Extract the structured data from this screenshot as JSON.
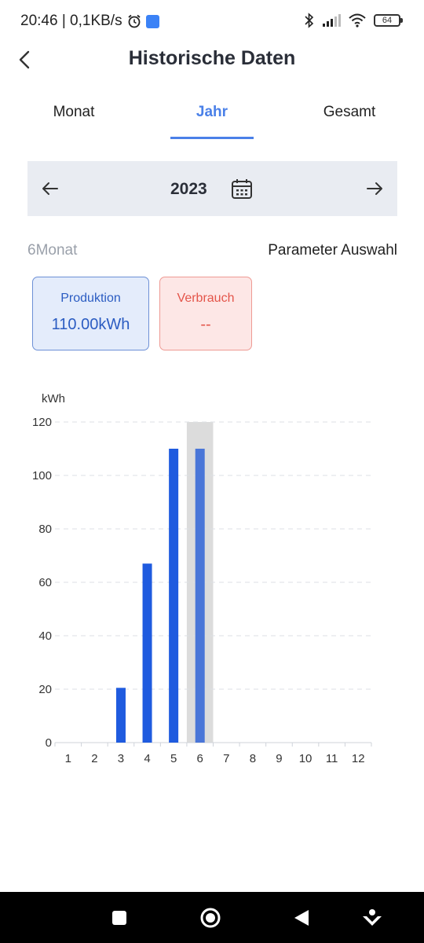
{
  "status_bar": {
    "time_speed": "20:46 | 0,1KB/s",
    "battery": "64"
  },
  "header": {
    "title": "Historische Daten"
  },
  "tabs": [
    {
      "label": "Monat",
      "active": false
    },
    {
      "label": "Jahr",
      "active": true
    },
    {
      "label": "Gesamt",
      "active": false
    }
  ],
  "year_selector": {
    "year": "2023"
  },
  "params": {
    "period": "6Monat",
    "select_label": "Parameter Auswahl"
  },
  "cards": {
    "production": {
      "title": "Produktion",
      "value": "110.00kWh"
    },
    "consumption": {
      "title": "Verbrauch",
      "value": "--"
    }
  },
  "colors": {
    "accent": "#4a80e8",
    "bar": "#1f5bdf",
    "bar_selected": "#4a76d8",
    "highlight": "#dcdcdc"
  },
  "chart_data": {
    "type": "bar",
    "ylabel": "kWh",
    "categories": [
      "1",
      "2",
      "3",
      "4",
      "5",
      "6",
      "7",
      "8",
      "9",
      "10",
      "11",
      "12"
    ],
    "values": [
      0,
      0,
      20.5,
      67,
      110,
      110,
      0,
      0,
      0,
      0,
      0,
      0
    ],
    "ylim": [
      0,
      120
    ],
    "yticks": [
      0,
      20,
      40,
      60,
      80,
      100,
      120
    ],
    "selected_index": 5,
    "grid": true
  }
}
